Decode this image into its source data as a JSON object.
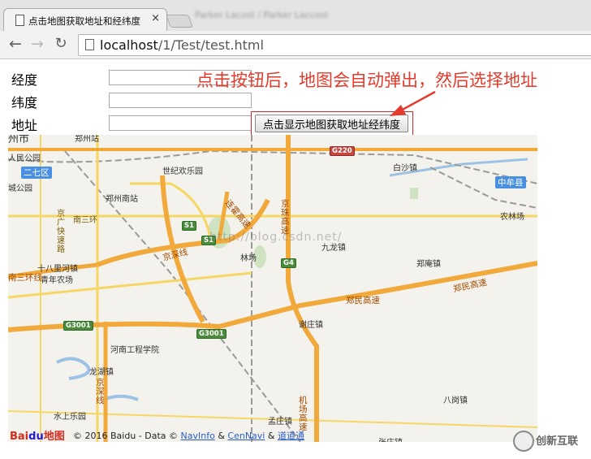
{
  "browser": {
    "tab_title": "点击地图获取地址和经纬度",
    "tab_close": "×",
    "background_tab_title": "Parker Lacost / Parker Laccost",
    "url_host": "localhost",
    "url_path": "/1/Test/test.html",
    "back_glyph": "←",
    "forward_glyph": "→",
    "reload_glyph": "↻"
  },
  "form": {
    "longitude_label": "经度",
    "latitude_label": "纬度",
    "address_label": "地址",
    "longitude_value": "",
    "latitude_value": "",
    "address_value": "",
    "show_map_button": "点击显示地图获取地址经纬度"
  },
  "annotation": {
    "hint_text": "点击按钮后，地图会自动弹出，然后选择地址",
    "hint_color": "#e43b2c"
  },
  "map": {
    "places": [
      "州市",
      "郑州站",
      "二七区",
      "人民公园",
      "城公园",
      "世纪欢乐园",
      "郑州南站",
      "南三环",
      "京广快速路",
      "十八里河镇",
      "青年农场",
      "南三环线",
      "京深线",
      "连霍高速",
      "京珠高速",
      "林场",
      "九龙镇",
      "白沙镇",
      "中牟县",
      "农林场",
      "郑庵镇",
      "郑民高速",
      "谢庄镇",
      "河南工程学院",
      "龙湖镇",
      "京深线",
      "水上乐园",
      "八岗镇",
      "孟庄镇",
      "机场高速",
      "张庄镇",
      "中牟县"
    ],
    "shields": [
      "G220",
      "S1",
      "S1",
      "G4",
      "G3001",
      "G3001"
    ],
    "highlight_labels": [
      "二七区",
      "中牟县"
    ],
    "watermark": "http://blog.csdn.net/",
    "logo_red": "Bai",
    "logo_blue": "du",
    "logo_cn": "地图",
    "copyright_prefix": "© 2016 Baidu - Data ©",
    "copyright_navinfo": "NavInfo",
    "copyright_and1": "&",
    "copyright_cennavi": "CenNavi",
    "copyright_and2": "&",
    "copyright_daodaotong": "道道通"
  },
  "watermark_brand": "创新互联"
}
